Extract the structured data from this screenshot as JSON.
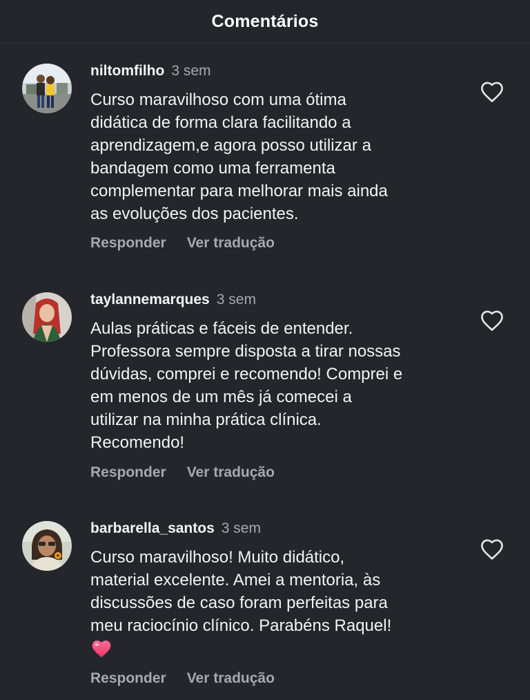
{
  "header": {
    "title": "Comentários"
  },
  "icons": {
    "like": "heart-outline-icon",
    "emoji": "pink-heart-emoji"
  },
  "colors": {
    "background": "#25262b",
    "secondary_text": "#a8a9ae",
    "emoji_heart": "#f0477a"
  },
  "comments": [
    {
      "username": "niltomfilho",
      "time": "3 sem",
      "lines": [
        "Curso maravilhoso com uma ótima",
        "didática de forma clara facilitando a",
        "aprendizagem,e agora posso utilizar a",
        "bandagem como uma ferramenta",
        "complementar para melhorar mais ainda",
        "as evoluções dos pacientes."
      ],
      "reply_label": "Responder",
      "translate_label": "Ver tradução"
    },
    {
      "username": "taylannemarques",
      "time": "3 sem",
      "lines": [
        "Aulas práticas e fáceis de entender.",
        "Professora sempre disposta a tirar nossas",
        "dúvidas, comprei e recomendo! Comprei e",
        "em menos de um mês já comecei a",
        "utilizar na minha prática clínica.",
        "Recomendo!"
      ],
      "reply_label": "Responder",
      "translate_label": "Ver tradução"
    },
    {
      "username": "barbarella_santos",
      "time": "3 sem",
      "lines": [
        "Curso maravilhoso! Muito didático,",
        "material excelente. Amei a mentoria,  às",
        "discussões de caso foram perfeitas para",
        "meu raciocínio clínico. Parabéns Raquel!"
      ],
      "reply_label": "Responder",
      "translate_label": "Ver tradução"
    }
  ]
}
